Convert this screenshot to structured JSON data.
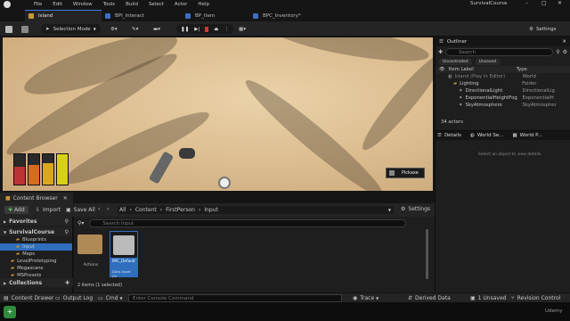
{
  "window": {
    "project": "SurvivalCourse",
    "menus": [
      "File",
      "Edit",
      "Window",
      "Tools",
      "Build",
      "Select",
      "Actor",
      "Help"
    ],
    "tabs": [
      {
        "label": "Island",
        "active": true,
        "color": "#c8963b"
      },
      {
        "label": "BPI_Interact",
        "active": false,
        "color": "#3d6ec4"
      },
      {
        "label": "BP_Item",
        "active": false,
        "color": "#3d6ec4"
      },
      {
        "label": "BPC_Inventory*",
        "active": false,
        "color": "#3d6ec4"
      }
    ]
  },
  "toolbar": {
    "selection_mode": "Selection Mode",
    "settings": "Settings"
  },
  "viewport": {
    "pickup_label": "Pickaxe",
    "hotbar_colors": [
      "#b33",
      "#d86b1d",
      "#d8a81d",
      "#d8cf1d"
    ]
  },
  "outliner": {
    "title": "Outliner",
    "search_placeholder": "Search",
    "filters": [
      "Uncontrolled",
      "Unsaved"
    ],
    "col_label": "Item Label",
    "col_type": "Type",
    "sort_indicator": "▼",
    "rows": [
      {
        "label": "Island (Play In Editor)",
        "type": "World",
        "indent": 0,
        "icon": "world-icon",
        "dim": true
      },
      {
        "label": "Lighting",
        "type": "Folder",
        "indent": 1,
        "icon": "folder-icon",
        "dim": false
      },
      {
        "label": "DirectionalLight",
        "type": "DirectionalLig",
        "indent": 2,
        "icon": "light-icon",
        "dim": false
      },
      {
        "label": "ExponentialHeightFog",
        "type": "ExponentialH",
        "indent": 2,
        "icon": "fog-icon",
        "dim": false
      },
      {
        "label": "SkyAtmosphere",
        "type": "SkyAtmosphere",
        "indent": 2,
        "icon": "sky-icon",
        "dim": false
      }
    ],
    "actor_count": "34 actors"
  },
  "details": {
    "tabs": [
      "Details",
      "World Se...",
      "World P..."
    ],
    "empty_message": "Select an object to view details."
  },
  "content_browser": {
    "tab_label": "Content Browser",
    "add_label": "Add",
    "import_label": "Import",
    "save_all_label": "Save All",
    "path": [
      "All",
      "Content",
      "FirstPerson",
      "Input"
    ],
    "settings": "Settings",
    "favorites": "Favorites",
    "root": "SurvivalCourse",
    "folders": [
      "Blueprints",
      "Input",
      "Maps",
      "LevelPrototyping",
      "Megascans",
      "MSPresets"
    ],
    "collections": "Collections",
    "search_placeholder": "Search Input",
    "assets": [
      {
        "name": "Actions",
        "kind": "folder",
        "selected": false
      },
      {
        "name": "IMC_Default",
        "subtitle": "Data Asset (In",
        "kind": "asset",
        "selected": true
      }
    ],
    "status": "2 items (1 selected)"
  },
  "statusbar": {
    "content_drawer": "Content Drawer",
    "output_log": "Output Log",
    "cmd": "Cmd",
    "console_placeholder": "Enter Console Command",
    "trace": "Trace",
    "derived_data": "Derived Data",
    "unsaved": "1 Unsaved",
    "revision_control": "Revision Control"
  },
  "watermark": "Udemy"
}
